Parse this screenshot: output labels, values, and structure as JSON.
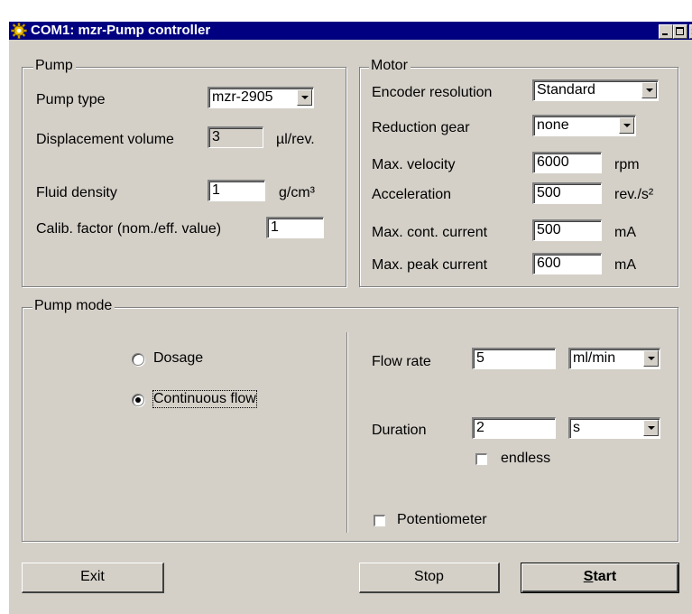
{
  "window": {
    "title": "COM1: mzr-Pump controller"
  },
  "pump": {
    "legend": "Pump",
    "pump_type_label": "Pump type",
    "pump_type_value": "mzr-2905",
    "displacement_label": "Displacement volume",
    "displacement_value": "3",
    "displacement_unit": "µl/rev.",
    "density_label": "Fluid density",
    "density_value": "1",
    "density_unit": "g/cm³",
    "calib_label": "Calib. factor (nom./eff. value)",
    "calib_value": "1"
  },
  "motor": {
    "legend": "Motor",
    "encoder_label": "Encoder resolution",
    "encoder_value": "Standard",
    "gear_label": "Reduction gear",
    "gear_value": "none",
    "velocity_label": "Max. velocity",
    "velocity_value": "6000",
    "velocity_unit": "rpm",
    "accel_label": "Acceleration",
    "accel_value": "500",
    "accel_unit": "rev./s²",
    "cont_current_label": "Max. cont. current",
    "cont_current_value": "500",
    "cont_current_unit": "mA",
    "peak_current_label": "Max. peak current",
    "peak_current_value": "600",
    "peak_current_unit": "mA"
  },
  "mode": {
    "legend": "Pump mode",
    "dosage_label": "Dosage",
    "dosage_selected": false,
    "continuous_label": "Continuous flow",
    "continuous_selected": true,
    "flow_label": "Flow rate",
    "flow_value": "5",
    "flow_unit": "ml/min",
    "duration_label": "Duration",
    "duration_value": "2",
    "duration_unit": "s",
    "endless_label": "endless",
    "endless_checked": false,
    "potentiometer_label": "Potentiometer",
    "potentiometer_checked": false
  },
  "buttons": {
    "exit": "Exit",
    "stop": "Stop",
    "start_mnemonic": "S",
    "start_rest": "tart"
  },
  "icons": {
    "app": "gear-icon",
    "minimize": "minimize-icon",
    "maximize": "maximize-icon",
    "close": "close-icon"
  }
}
